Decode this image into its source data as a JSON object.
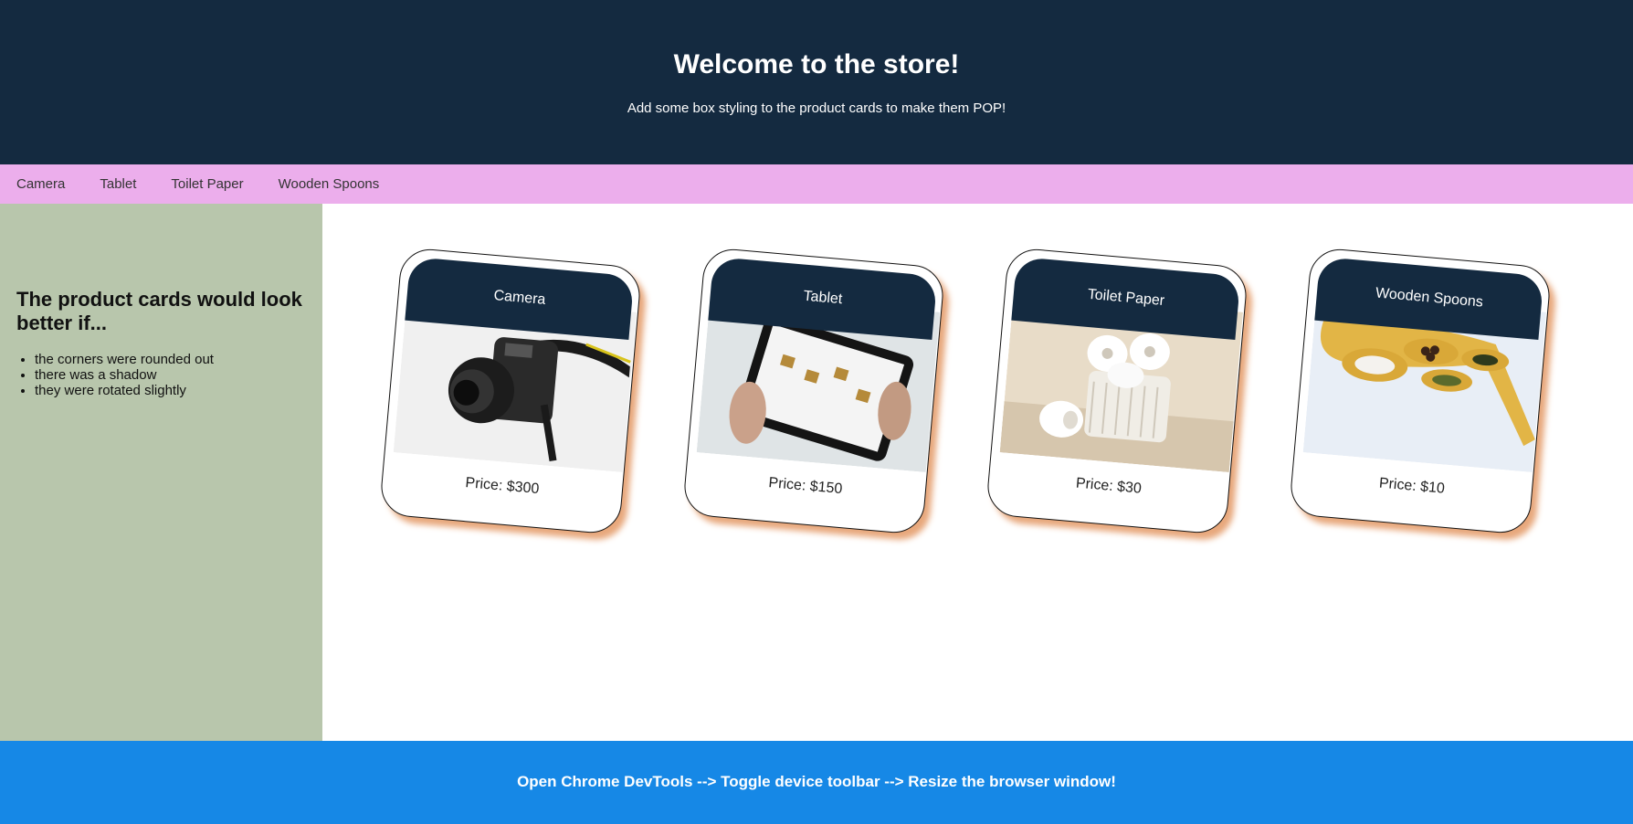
{
  "header": {
    "title": "Welcome to the store!",
    "subtitle": "Add some box styling to the product cards to make them POP!"
  },
  "nav": {
    "items": [
      {
        "label": "Camera"
      },
      {
        "label": "Tablet"
      },
      {
        "label": "Toilet Paper"
      },
      {
        "label": "Wooden Spoons"
      }
    ]
  },
  "sidebar": {
    "heading": "The product cards would look better if...",
    "bullets": [
      "the corners were rounded out",
      "there was a shadow",
      "they were rotated slightly"
    ]
  },
  "cards": [
    {
      "title": "Camera",
      "price": "Price: $300",
      "icon": "camera-photo"
    },
    {
      "title": "Tablet",
      "price": "Price: $150",
      "icon": "tablet-photo"
    },
    {
      "title": "Toilet Paper",
      "price": "Price: $30",
      "icon": "toilet-paper-photo"
    },
    {
      "title": "Wooden Spoons",
      "price": "Price: $10",
      "icon": "wooden-spoons-photo"
    }
  ],
  "footer": {
    "text": "Open Chrome DevTools --> Toggle device toolbar --> Resize the browser window!"
  },
  "colors": {
    "header_bg": "#142a40",
    "nav_bg": "#ecaeec",
    "sidebar_bg": "#b8c6ac",
    "footer_bg": "#1688e6",
    "shadow": "#e8a87c"
  }
}
